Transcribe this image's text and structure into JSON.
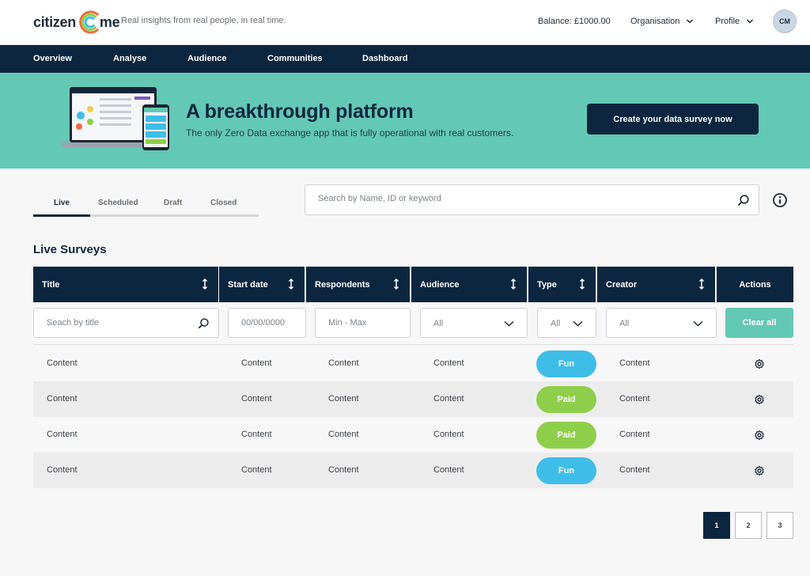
{
  "header": {
    "logo_left": "citizen",
    "logo_right": "me",
    "tagline": "Real insights from real people, in real time.",
    "balance": "Balance: £1000.00",
    "organisation_label": "Organisation",
    "profile_label": "Profile",
    "avatar_initials": "CM"
  },
  "nav": {
    "items": [
      "Overview",
      "Analyse",
      "Audience",
      "Communities",
      "Dashboard"
    ]
  },
  "banner": {
    "title": "A breakthrough platform",
    "subtitle": "The only Zero Data exchange app that is fully operational with real customers.",
    "cta_label": "Create  your data survey now"
  },
  "tabs": {
    "items": [
      "Live",
      "Scheduled",
      "Draft",
      "Closed"
    ],
    "active": "Live"
  },
  "search": {
    "placeholder": "Search by Name, ID or keyword"
  },
  "section_title": "Live Surveys",
  "table": {
    "columns": [
      "Title",
      "Start date",
      "Respondents",
      "Audience",
      "Type",
      "Creator",
      "Actions"
    ],
    "filters": {
      "title_placeholder": "Seach by title",
      "date_placeholder": "00/00/0000",
      "respondents_placeholder": "Min - Max",
      "audience_value": "All",
      "type_value": "All",
      "creator_value": "All",
      "clear_label": "Clear all"
    },
    "rows": [
      {
        "title": "Content",
        "start_date": "Content",
        "respondents": "Content",
        "audience": "Content",
        "type": "Fun",
        "creator": "Content"
      },
      {
        "title": "Content",
        "start_date": "Content",
        "respondents": "Content",
        "audience": "Content",
        "type": "Paid",
        "creator": "Content"
      },
      {
        "title": "Content",
        "start_date": "Content",
        "respondents": "Content",
        "audience": "Content",
        "type": "Paid",
        "creator": "Content"
      },
      {
        "title": "Content",
        "start_date": "Content",
        "respondents": "Content",
        "audience": "Content",
        "type": "Fun",
        "creator": "Content"
      }
    ]
  },
  "pagination": {
    "pages": [
      "1",
      "2",
      "3"
    ],
    "current": "1"
  },
  "colors": {
    "navy": "#0d2640",
    "teal": "#63c8b4",
    "fun_pill": "#3fbde9",
    "paid_pill": "#8fce4a"
  }
}
